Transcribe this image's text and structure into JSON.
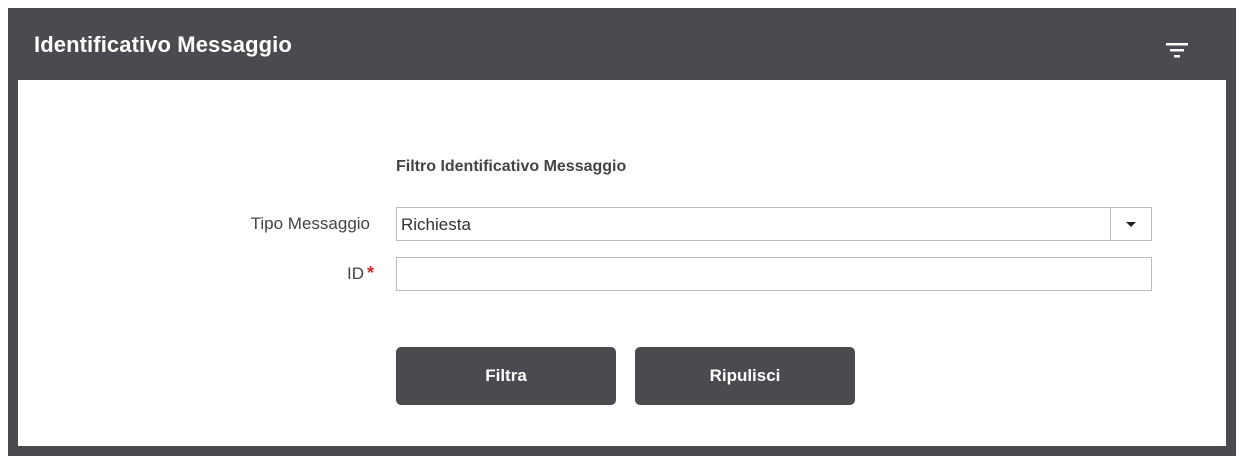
{
  "panel": {
    "title": "Identificativo Messaggio"
  },
  "form": {
    "section_title": "Filtro Identificativo Messaggio",
    "tipo_messaggio": {
      "label": "Tipo Messaggio",
      "selected": "Richiesta"
    },
    "id": {
      "label": "ID",
      "required_mark": "*",
      "value": ""
    }
  },
  "actions": {
    "filtra_label": "Filtra",
    "ripulisci_label": "Ripulisci"
  },
  "icons": {
    "header_action": "filter-icon",
    "select_arrow": "caret-down-icon"
  },
  "colors": {
    "header_bg": "#4a4a4f",
    "button_bg": "#4a4a4f",
    "required": "#d8262a"
  }
}
